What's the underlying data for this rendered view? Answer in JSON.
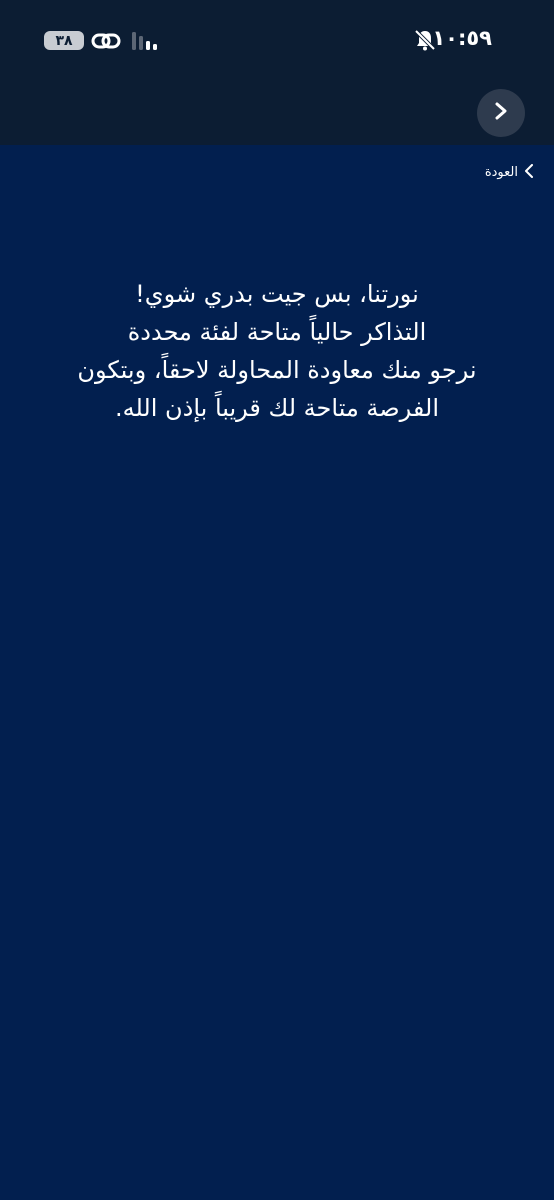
{
  "status_bar": {
    "time": "١٠:٥٩",
    "battery_level": "٣٨",
    "icons": [
      "bell-off-icon",
      "link-icon",
      "signal-icon"
    ]
  },
  "nav": {
    "back_label": "العودة",
    "forward_icon": "chevron-right-icon"
  },
  "message": {
    "lines": [
      "نورتنا، بس جيت بدري شوي!",
      "التذاكر حالياً متاحة لفئة محددة",
      "نرجو منك معاودة المحاولة لاحقاً، وبتكون",
      "الفرصة متاحة لك قريباً بإذن الله."
    ]
  },
  "colors": {
    "background": "#021f4f",
    "header": "#0c1d33",
    "text": "#ffffff"
  }
}
